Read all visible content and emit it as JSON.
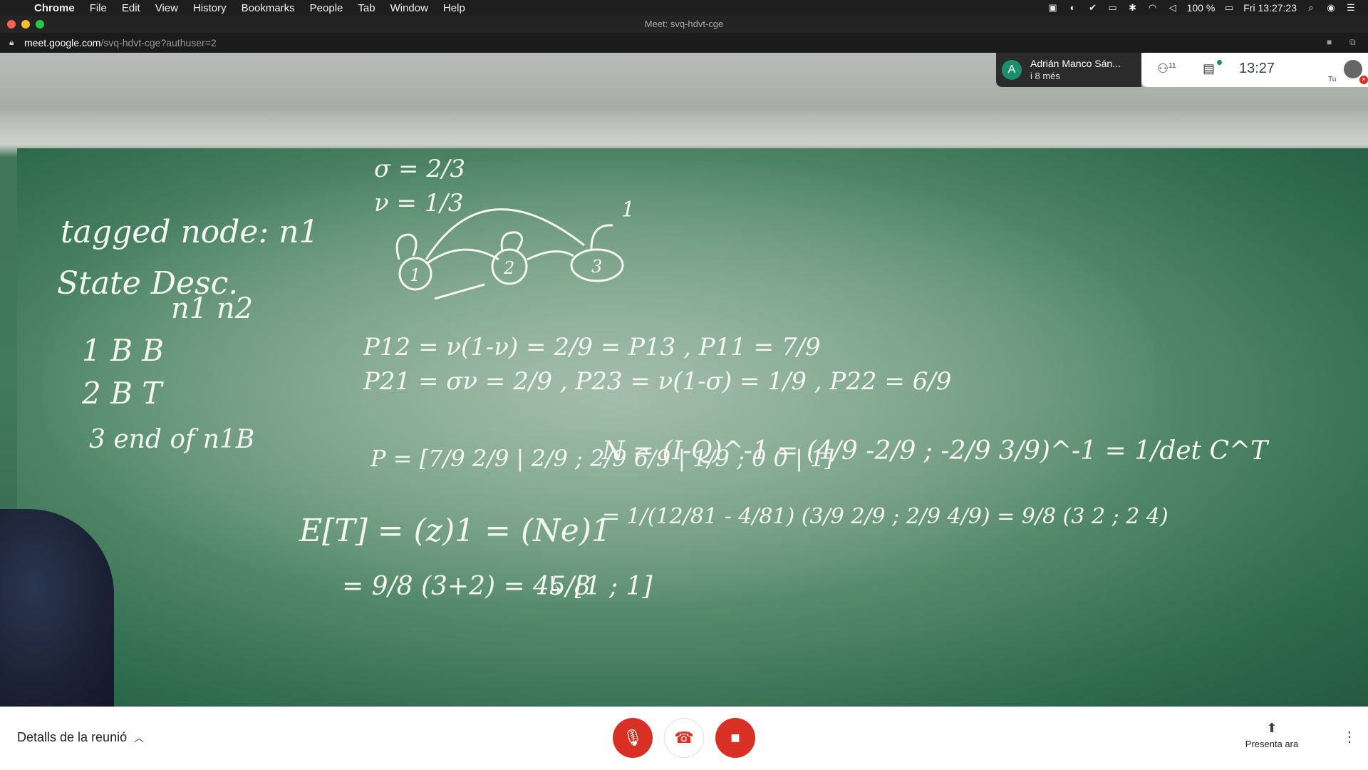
{
  "menubar": {
    "apple": "",
    "items": [
      "Chrome",
      "File",
      "Edit",
      "View",
      "History",
      "Bookmarks",
      "People",
      "Tab",
      "Window",
      "Help"
    ],
    "battery": "100 %",
    "datetime": "Fri 13:27:23"
  },
  "window": {
    "title": "Meet: svq-hdvt-cge"
  },
  "urlbar": {
    "host": "meet.google.com",
    "path": "/svq-hdvt-cge?authuser=2"
  },
  "chat_toast": {
    "initial": "A",
    "name": "Adrián Manco Sán...",
    "time": "i 8 més"
  },
  "meet_panel": {
    "participants": "11",
    "clock": "13:27",
    "self_label": "Tu"
  },
  "bottom": {
    "details_label": "Detalls de la reunió",
    "present_label": "Presenta ara"
  },
  "board": {
    "lines": [
      "σ = 2/3",
      "ν = 1/3",
      "tagged node: n1",
      "State Desc.",
      "n1 n2",
      "1   B   B",
      "2   B   T",
      "3   end of n1B",
      "P12 = ν(1-ν) = 2/9 = P13 , P11 = 7/9",
      "P21 = σν = 2/9 , P23 = ν(1-σ) = 1/9 , P22 = 6/9",
      "P = [7/9 2/9 | 2/9 ; 2/9 6/9 | 1/9 ; 0 0 | 1]",
      "N = (I-Q)^-1 = (4/9 -2/9 ; -2/9 3/9)^-1 = 1/det C^T",
      "= 1/(12/81 - 4/81) (3/9 2/9 ; 2/9 4/9) = 9/8 (3 2 ; 2 4)",
      "E[T] = (z)1 = (Ne)1",
      "= 9/8 (3+2) = 45/8",
      "↳ [1 ; 1]"
    ]
  },
  "colors": {
    "record_red": "#d93025",
    "chat_avatar": "#1e8e6a",
    "board_green": "#417a5c"
  }
}
